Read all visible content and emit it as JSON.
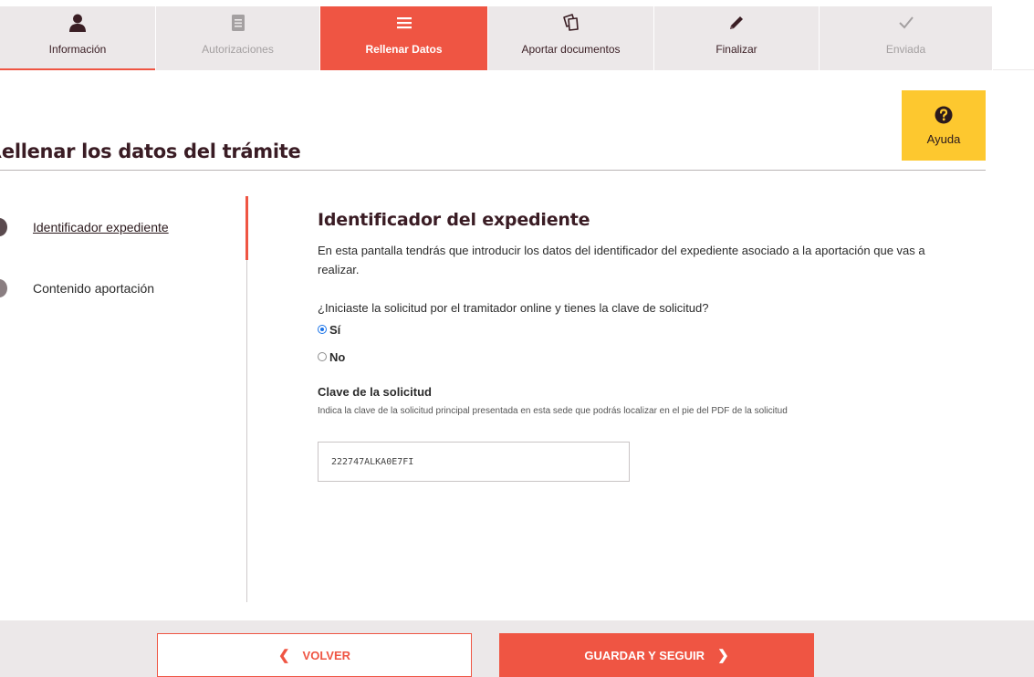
{
  "stepper": {
    "steps": [
      {
        "label": "Información",
        "icon": "person-icon",
        "state": "done"
      },
      {
        "label": "Autorizaciones",
        "icon": "document-icon",
        "state": "disabled"
      },
      {
        "label": "Rellenar Datos",
        "icon": "menu-icon",
        "state": "active"
      },
      {
        "label": "Aportar documentos",
        "icon": "documents-icon",
        "state": "normal"
      },
      {
        "label": "Finalizar",
        "icon": "pencil-icon",
        "state": "normal"
      },
      {
        "label": "Enviada",
        "icon": "check-icon",
        "state": "disabled"
      }
    ]
  },
  "help": {
    "label": "Ayuda",
    "icon": "question-circle-icon"
  },
  "page": {
    "title": "Rellenar los datos del trámite"
  },
  "side_nav": {
    "items": [
      {
        "label": "Identificador expediente",
        "current": true
      },
      {
        "label": "Contenido aportación",
        "current": false
      }
    ]
  },
  "form": {
    "section_title": "Identificador del expediente",
    "intro": "En esta pantalla tendrás que introducir los datos del identificador del expediente asociado a la aportación que vas a realizar.",
    "question": "¿Iniciaste la solicitud por el tramitador online y tienes la clave de solicitud?",
    "options": [
      {
        "label": "Sí",
        "checked": true
      },
      {
        "label": "No",
        "checked": false
      }
    ],
    "field_label": "Clave de la solicitud",
    "field_help": "Indica la clave de la solicitud principal presentada en esta sede que podrás localizar en el pie del PDF de la solicitud",
    "field_value": "222747ALKA0E7FI"
  },
  "actions": {
    "back_label": "VOLVER",
    "next_label": "GUARDAR Y SEGUIR"
  },
  "colors": {
    "accent": "#ef5543",
    "help_bg": "#fdc82f",
    "title": "#3a1c24",
    "step_bg": "#ece8e9"
  }
}
